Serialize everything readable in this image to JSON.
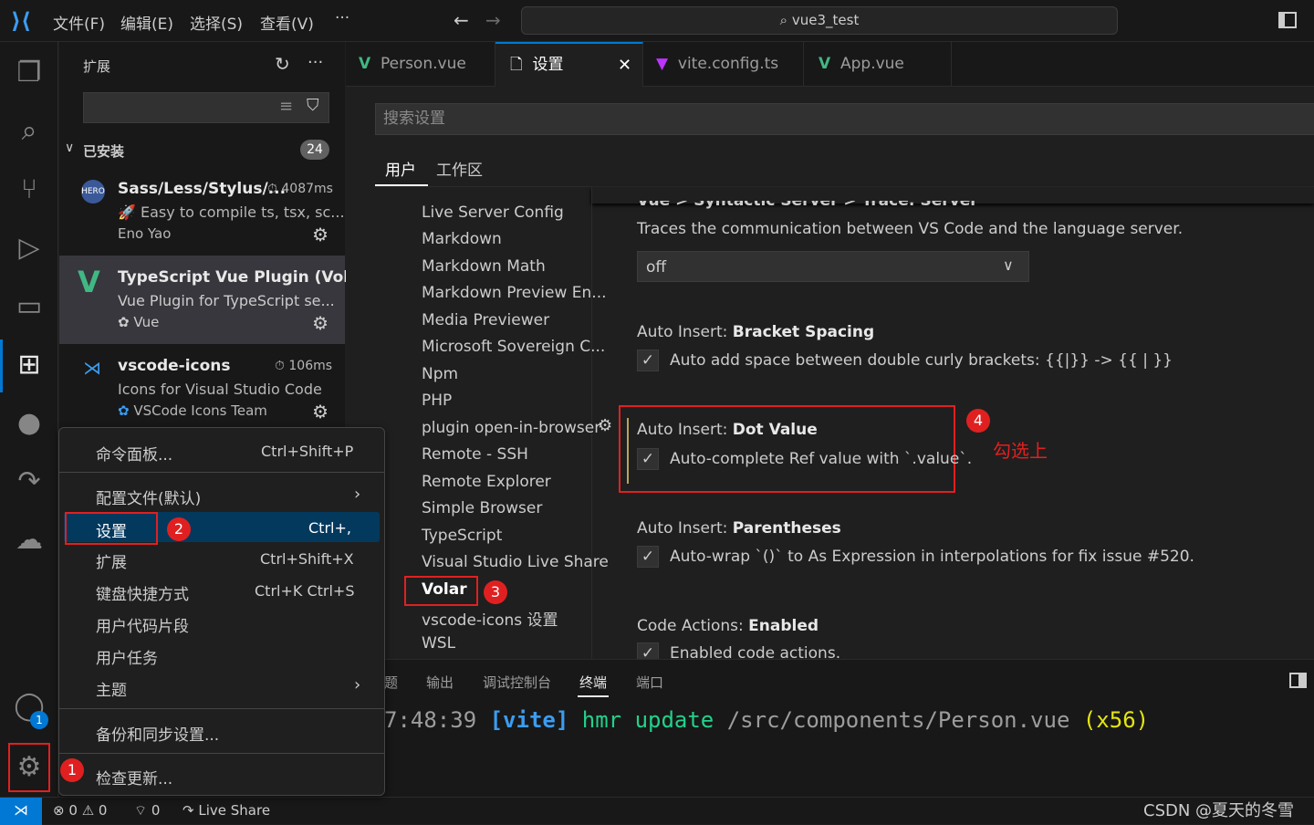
{
  "titlebar": {
    "menus": [
      "文件(F)",
      "编辑(E)",
      "选择(S)",
      "查看(V)"
    ],
    "more": "···",
    "search": "vue3_test"
  },
  "sidebar": {
    "title": "扩展",
    "installed_label": "已安装",
    "installed_count": "24",
    "extensions": [
      {
        "name": "Sass/Less/Stylus/...",
        "time": "4087ms",
        "desc": "🚀 Easy to compile ts, tsx, sc...",
        "publisher": "Eno Yao"
      },
      {
        "name": "TypeScript Vue Plugin (Vol...",
        "desc": "Vue Plugin for TypeScript se...",
        "publisher": "Vue"
      },
      {
        "name": "vscode-icons",
        "time": "106ms",
        "desc": "Icons for Visual Studio Code",
        "publisher": "VSCode Icons Team"
      }
    ]
  },
  "tabs": [
    {
      "label": "Person.vue"
    },
    {
      "label": "设置"
    },
    {
      "label": "vite.config.ts"
    },
    {
      "label": "App.vue"
    }
  ],
  "settings": {
    "search_placeholder": "搜索设置",
    "scope_tabs": [
      "用户",
      "工作区"
    ],
    "toc": [
      "Live Server Config",
      "Markdown",
      "Markdown Math",
      "Markdown Preview En...",
      "Media Previewer",
      "Microsoft Sovereign C...",
      "Npm",
      "PHP",
      "plugin open-in-browser",
      "Remote - SSH",
      "Remote Explorer",
      "Simple Browser",
      "TypeScript",
      "Visual Studio Live Share",
      "Volar",
      "vscode-icons 设置",
      "WSL"
    ],
    "cut_title": "Vue > Syntactic Server > Trace: Server",
    "trace_desc": "Traces the communication between VS Code and the language server.",
    "trace_value": "off",
    "items": [
      {
        "prefix": "Auto Insert: ",
        "name": "Bracket Spacing",
        "desc": "Auto add space between double curly brackets: {{|}} -> {{ | }}"
      },
      {
        "prefix": "Auto Insert: ",
        "name": "Dot Value",
        "desc": "Auto-complete Ref value with `.value`."
      },
      {
        "prefix": "Auto Insert: ",
        "name": "Parentheses",
        "desc": "Auto-wrap `()` to As Expression in interpolations for fix issue #520."
      },
      {
        "prefix": "Code Actions: ",
        "name": "Enabled",
        "desc": "Enabled code actions."
      }
    ]
  },
  "panel": {
    "tabs": [
      "题",
      "输出",
      "调试控制台",
      "终端",
      "端口"
    ],
    "terminal": {
      "time": "7:48:39",
      "tag": "[vite]",
      "cmd": "hmr update",
      "path": "/src/components/Person.vue",
      "count": "(x56)"
    }
  },
  "context_menu": {
    "items": [
      {
        "label": "命令面板...",
        "key": "Ctrl+Shift+P"
      },
      {
        "label": "配置文件(默认)",
        "key": ""
      },
      {
        "label": "设置",
        "key": "Ctrl+,"
      },
      {
        "label": "扩展",
        "key": "Ctrl+Shift+X"
      },
      {
        "label": "键盘快捷方式",
        "key": "Ctrl+K Ctrl+S"
      },
      {
        "label": "用户代码片段",
        "key": ""
      },
      {
        "label": "用户任务",
        "key": ""
      },
      {
        "label": "主题",
        "key": ""
      },
      {
        "label": "备份和同步设置...",
        "key": ""
      },
      {
        "label": "检查更新...",
        "key": ""
      }
    ]
  },
  "annotations": {
    "b1": "1",
    "b2": "2",
    "b3": "3",
    "b4": "4",
    "note": "勾选上",
    "account_badge": "1"
  },
  "statusbar": {
    "errors": "0",
    "warnings": "0",
    "ports": "0",
    "liveshare": "Live Share",
    "watermark": "CSDN @夏天的冬雪"
  },
  "colors": {
    "accent": "#0078d4",
    "red": "#e02020",
    "vue_green": "#41b883"
  }
}
